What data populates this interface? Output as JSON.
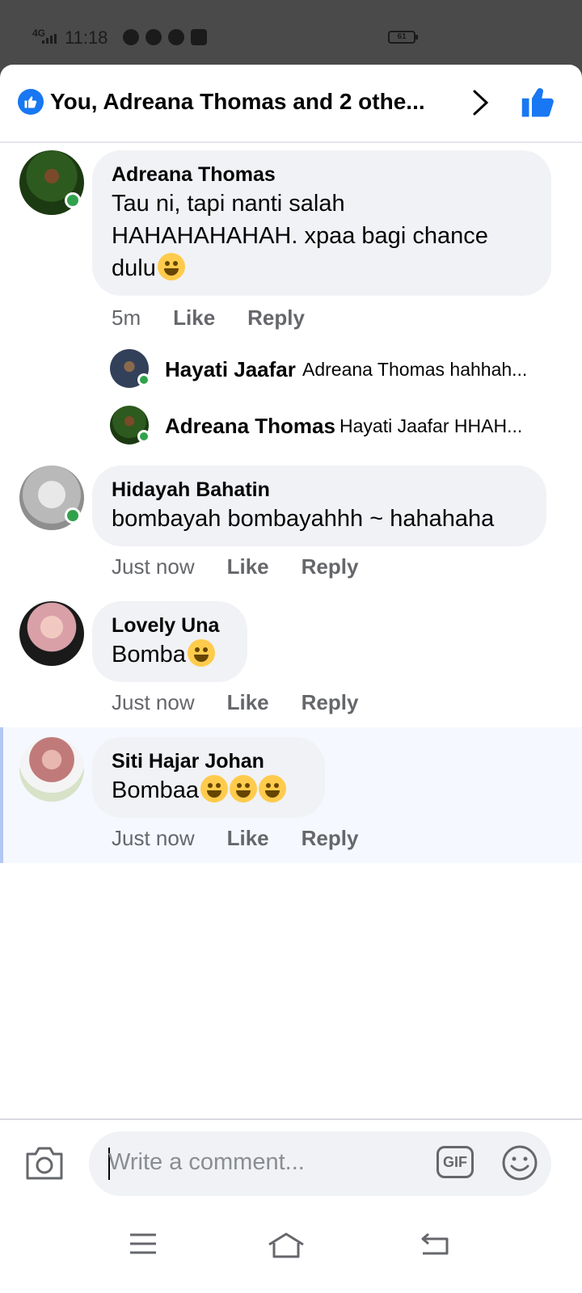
{
  "status_bar": {
    "network": "4G",
    "time": "11:18",
    "battery": "61",
    "apps": [
      "whatsapp-icon",
      "messenger-icon",
      "telegram-icon",
      "facebook-icon"
    ]
  },
  "header": {
    "title": "You, Adreana Thomas and 2 othe..."
  },
  "comments": [
    {
      "name": "Adreana Thomas",
      "text_lines": [
        "Tau ni, tapi nanti salah",
        "HAHAHAHAHAH. xpaa bagi chance",
        "dulu"
      ],
      "emoji": [
        "face-with-tears-of-joy"
      ],
      "time": "5m",
      "like": "Like",
      "reply": "Reply",
      "replies": [
        {
          "name": "Hayati Jaafar",
          "text": "Adreana Thomas hahhah..."
        },
        {
          "name": "Adreana Thomas",
          "text": "Hayati Jaafar HHAH..."
        }
      ]
    },
    {
      "name": "Hidayah Bahatin",
      "text": "bombayah bombayahhh ~ hahahaha",
      "time": "Just now",
      "like": "Like",
      "reply": "Reply"
    },
    {
      "name": "Lovely Una",
      "text": "Bomba",
      "emoji": [
        "rolling-on-floor-laughing"
      ],
      "time": "Just now",
      "like": "Like",
      "reply": "Reply"
    },
    {
      "name": "Siti Hajar Johan",
      "text": "Bombaa",
      "emoji": [
        "face-with-hand-over-mouth",
        "face-with-hand-over-mouth",
        "grinning-face-with-smiling-eyes"
      ],
      "time": "Just now",
      "like": "Like",
      "reply": "Reply"
    }
  ],
  "composer": {
    "placeholder": "Write a comment...",
    "gif": "GIF"
  },
  "colors": {
    "accent": "#1877f2",
    "bubble": "#f0f2f5",
    "online": "#31a24c",
    "secondary_text": "#65676b"
  }
}
